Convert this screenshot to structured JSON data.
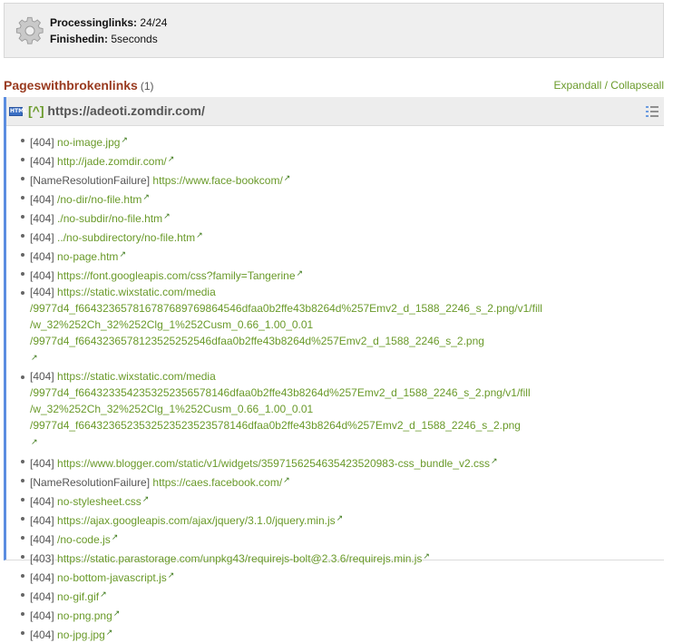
{
  "status": {
    "icon": "gear-icon",
    "processing_label": "Processing links:",
    "processing_value": "24 / 24",
    "finished_label": "Finished in:",
    "finished_value": "5 seconds"
  },
  "section": {
    "title": "Pages with broken links",
    "count": "(1)",
    "expand_all": "Expand all",
    "separator": "/",
    "collapse_all": "Collapse all"
  },
  "page": {
    "icon_label": "HTML",
    "caret": "[^]",
    "url": "https://adeoti.zomdir.com/",
    "external_glyph": "↗",
    "links": [
      {
        "code": "[404]",
        "url_lines": [
          "no-image.jpg"
        ]
      },
      {
        "code": "[404]",
        "url_lines": [
          "http://jade.zomdir.com/"
        ]
      },
      {
        "code": "[NameResolutionFailure]",
        "url_lines": [
          "https://www.face-bookcom/"
        ]
      },
      {
        "code": "[404]",
        "url_lines": [
          "/no-dir/no-file.htm"
        ]
      },
      {
        "code": "[404]",
        "url_lines": [
          "./no-subdir/no-file.htm"
        ]
      },
      {
        "code": "[404]",
        "url_lines": [
          "../no-subdirectory/no-file.htm"
        ]
      },
      {
        "code": "[404]",
        "url_lines": [
          "no-page.htm"
        ]
      },
      {
        "code": "[404]",
        "url_lines": [
          "https://font.googleapis.com/css?family=Tangerine"
        ]
      },
      {
        "code": "[404]",
        "url_lines": [
          "https://static.wixstatic.com/media",
          "/9977d4_f6643236578167876897698645 46dfaa0b2ffe43b8264d%257Emv2_d_1588_2246_s_2.png/v1/fill",
          "/w_32%252Ch_32%252Clg_1%252Cusm_0.66_1.00_0.01",
          "/9977d4_f66432365781235252525 46dfaa0b2ffe43b8264d%257Emv2_d_1588_2246_s_2.png"
        ]
      },
      {
        "code": "[404]",
        "url_lines": [
          "https://static.wixstatic.com/media",
          "/9977d4_f66432335423532523565781 46dfaa0b2ffe43b8264d%257Emv2_d_1588_2246_s_2.png/v1/fill",
          "/w_32%252Ch_32%252Clg_1%252Cusm_0.66_1.00_0.01",
          "/9977d4_f66432365235325235235235781 46dfaa0b2ffe43b8264d%257Emv2_d_1588_2246_s_2.png"
        ]
      },
      {
        "code": "[404]",
        "url_lines": [
          "https://www.blogger.com/static/v1/widgets/3597156254635423520983-css_bundle_v2.css"
        ]
      },
      {
        "code": "[NameResolutionFailure]",
        "url_lines": [
          "https://caes.facebook.com/"
        ]
      },
      {
        "code": "[404]",
        "url_lines": [
          "no-stylesheet.css"
        ]
      },
      {
        "code": "[404]",
        "url_lines": [
          "https://ajax.googleapis.com/ajax/jquery/3.1.0/jquery.min.js"
        ]
      },
      {
        "code": "[404]",
        "url_lines": [
          "/no-code.js"
        ]
      },
      {
        "code": "[403]",
        "url_lines": [
          "https://static.parastorage.com/unpkg43/requirejs-bolt@2.3.6/requirejs.min.js"
        ]
      },
      {
        "code": "[404]",
        "url_lines": [
          "no-bottom-javascript.js"
        ]
      },
      {
        "code": "[404]",
        "url_lines": [
          "no-gif.gif"
        ]
      },
      {
        "code": "[404]",
        "url_lines": [
          "no-png.png"
        ]
      },
      {
        "code": "[404]",
        "url_lines": [
          "no-jpg.jpg"
        ]
      }
    ]
  },
  "colors": {
    "section_title": "#993a1f",
    "link": "#6a9a2a",
    "accent_border": "#5b8de0"
  }
}
